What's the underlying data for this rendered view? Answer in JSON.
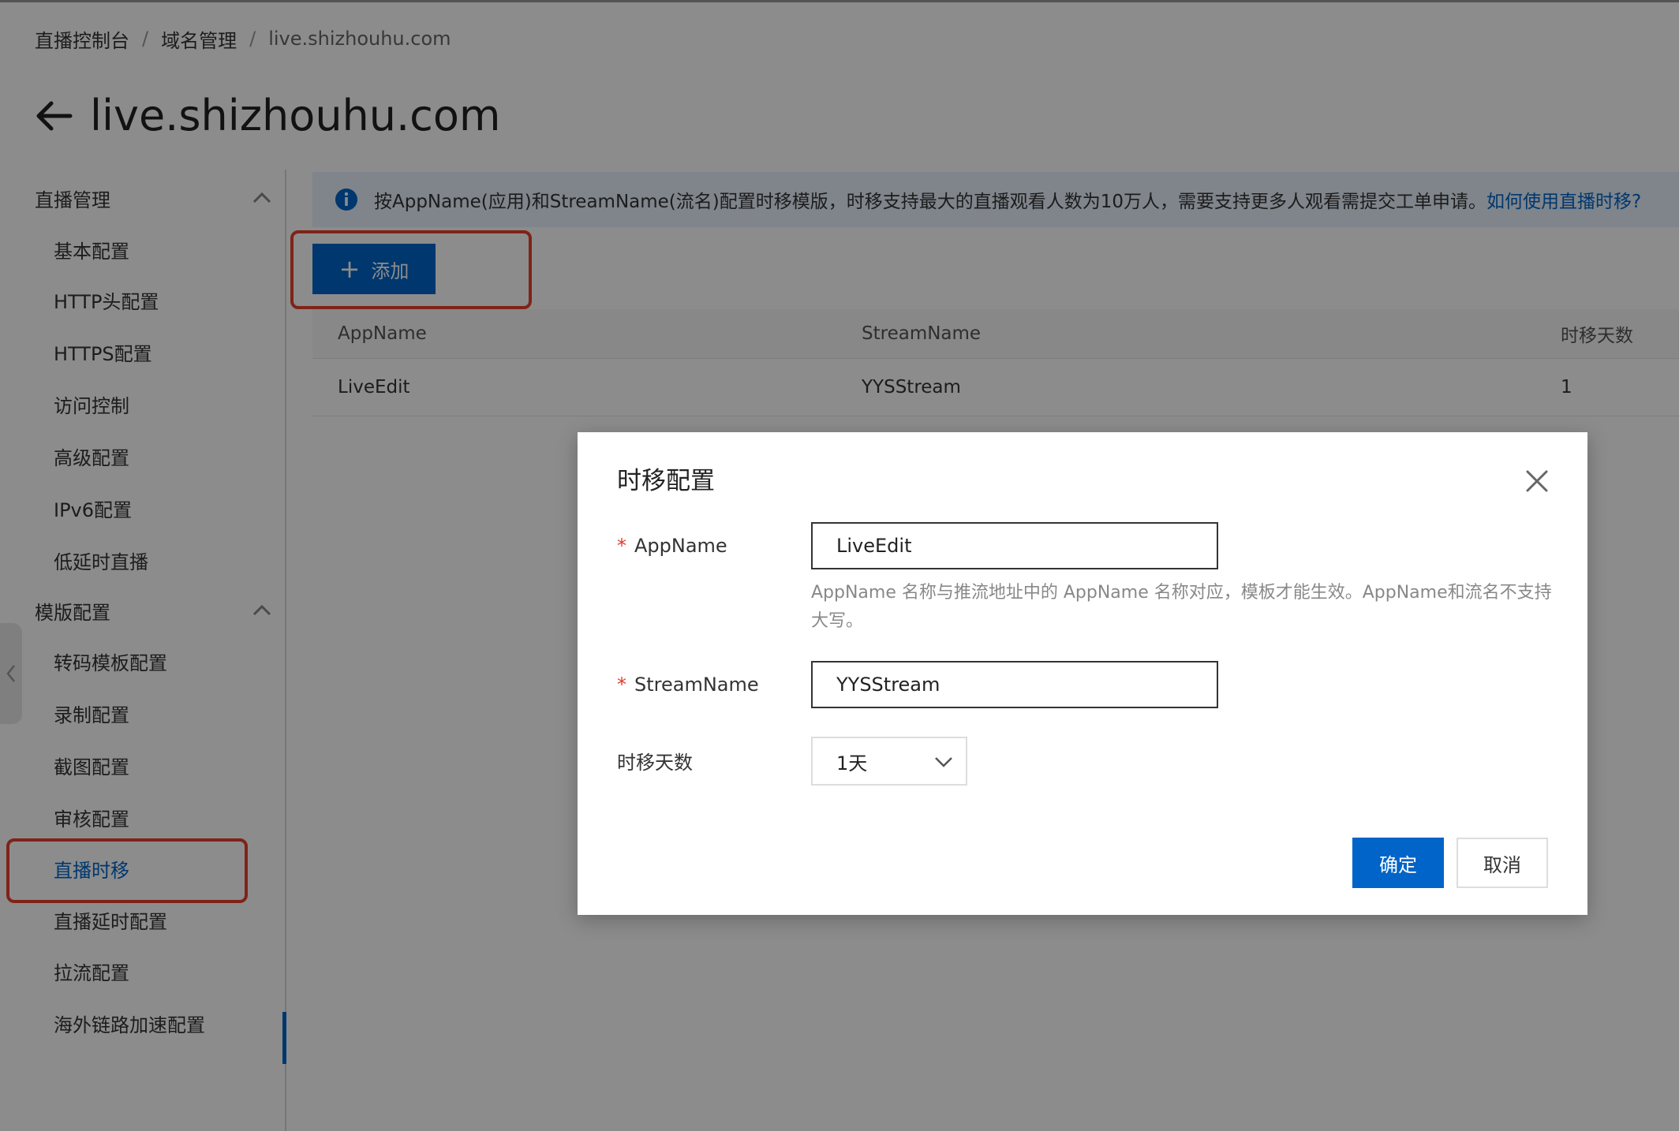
{
  "breadcrumb": [
    "直播控制台",
    "域名管理",
    "live.shizhouhu.com"
  ],
  "breadcrumb_separator": "/",
  "page_title": "live.shizhouhu.com",
  "sidebar": {
    "groups": [
      {
        "label": "直播管理",
        "items": [
          "基本配置",
          "HTTP头配置",
          "HTTPS配置",
          "访问控制",
          "高级配置",
          "IPv6配置",
          "低延时直播"
        ]
      },
      {
        "label": "模版配置",
        "items": [
          "转码模板配置",
          "录制配置",
          "截图配置",
          "审核配置",
          "直播时移",
          "直播延时配置",
          "拉流配置",
          "海外链路加速配置"
        ]
      }
    ],
    "active_item": "直播时移"
  },
  "notice": {
    "text": "按AppName(应用)和StreamName(流名)配置时移模版，时移支持最大的直播观看人数为10万人，需要支持更多人观看需提交工单申请。",
    "link": "如何使用直播时移?"
  },
  "add_button": {
    "icon": "plus-icon",
    "label": "添加"
  },
  "table": {
    "columns": [
      "AppName",
      "StreamName",
      "时移天数"
    ],
    "rows": [
      [
        "LiveEdit",
        "YYSStream",
        "1"
      ]
    ]
  },
  "dialog": {
    "title": "时移配置",
    "required_mark": "*",
    "fields": {
      "appname": {
        "label": "AppName",
        "value": "LiveEdit"
      },
      "appname_hint": "AppName 名称与推流地址中的 AppName 名称对应，模板才能生效。AppName和流名不支持大写。",
      "streamname": {
        "label": "StreamName",
        "value": "YYSStream"
      },
      "days": {
        "label": "时移天数",
        "value": "1天"
      }
    },
    "ok": "确定",
    "cancel": "取消"
  },
  "colors": {
    "primary": "#0064c8",
    "highlight": "#e8402f",
    "required": "#e03b2c",
    "notice_bg": "#e8f2fd"
  }
}
